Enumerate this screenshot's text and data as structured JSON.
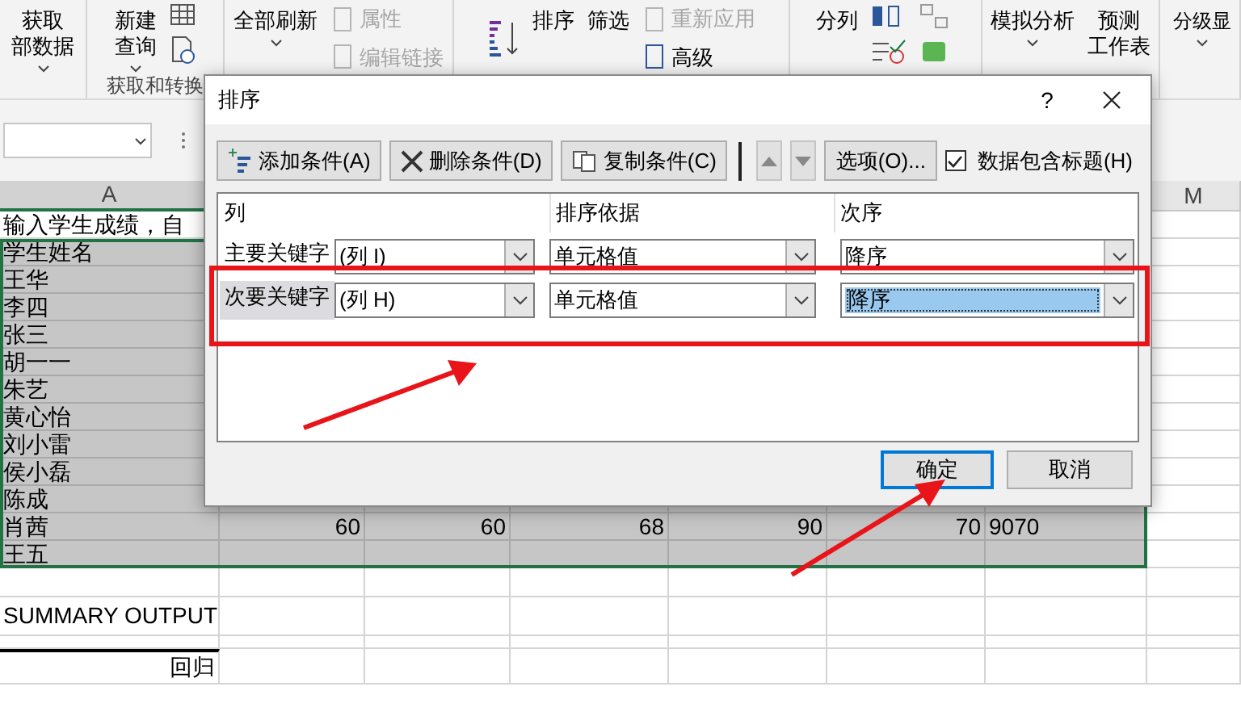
{
  "ribbon": {
    "groups": [
      {
        "items": [
          {
            "kind": "large",
            "lines": [
              "获取",
              "部数据"
            ],
            "caret": true
          }
        ]
      },
      {
        "label": "获取和转换",
        "items": [
          {
            "kind": "large",
            "lines": [
              "新建",
              "查询"
            ],
            "caret": true
          },
          {
            "kind": "icon_column"
          }
        ]
      },
      {
        "items": [
          {
            "kind": "large",
            "lines": [
              "全部刷新"
            ],
            "caret": true
          },
          {
            "kind": "stack",
            "items": [
              {
                "text": "属性",
                "disabled": true
              },
              {
                "text": "编辑链接",
                "disabled": true
              }
            ]
          }
        ]
      },
      {
        "items": [
          {
            "kind": "sort_icon"
          },
          {
            "kind": "large",
            "lines": [
              "排序"
            ],
            "caret": false
          },
          {
            "kind": "large",
            "lines": [
              "筛选"
            ],
            "caret": false
          },
          {
            "kind": "stack",
            "items": [
              {
                "text": "重新应用",
                "disabled": true
              },
              {
                "text": "高级",
                "disabled": false
              }
            ]
          }
        ]
      },
      {
        "items": [
          {
            "kind": "large",
            "lines": [
              "分列"
            ],
            "caret": false
          },
          {
            "kind": "icon_grid"
          }
        ]
      },
      {
        "items": [
          {
            "kind": "large",
            "lines": [
              "模拟分析"
            ],
            "caret": true
          },
          {
            "kind": "large",
            "lines": [
              "预测",
              "工作表"
            ],
            "caret": false
          }
        ]
      },
      {
        "items": [
          {
            "kind": "large",
            "lines": [
              "分级显"
            ],
            "caret": true
          }
        ]
      }
    ]
  },
  "sheet": {
    "column_headers": [
      "A",
      "M"
    ],
    "rows": [
      {
        "cells": [
          "输入学生成绩，自"
        ],
        "selected": false
      },
      {
        "cells": [
          "学生姓名"
        ],
        "selected": true
      },
      {
        "cells": [
          "王华"
        ],
        "selected": true
      },
      {
        "cells": [
          "李四"
        ],
        "selected": true
      },
      {
        "cells": [
          "张三"
        ],
        "selected": true
      },
      {
        "cells": [
          "胡一一"
        ],
        "selected": true
      },
      {
        "cells": [
          "朱艺"
        ],
        "selected": true
      },
      {
        "cells": [
          "黄心怡"
        ],
        "selected": true
      },
      {
        "cells": [
          "刘小雷"
        ],
        "selected": true
      },
      {
        "cells": [
          "侯小磊"
        ],
        "selected": true
      },
      {
        "cells": [
          "陈成"
        ],
        "selected": true
      },
      {
        "cells": [
          "肖茜",
          "60",
          "60",
          "68",
          "90",
          "70",
          "9070"
        ],
        "selected": true
      },
      {
        "cells": [
          "王五"
        ],
        "selected": true
      }
    ],
    "summary": {
      "title": "SUMMARY OUTPUT",
      "table_heading": "回归"
    }
  },
  "dialog": {
    "title": "排序",
    "help": "?",
    "toolbar": [
      {
        "kind": "add",
        "label": "添加条件(A)"
      },
      {
        "kind": "delete",
        "label": "删除条件(D)"
      },
      {
        "kind": "copy",
        "label": "复制条件(C)"
      },
      {
        "kind": "up"
      },
      {
        "kind": "down"
      },
      {
        "kind": "text",
        "label": "选项(O)..."
      }
    ],
    "has_headers": {
      "label": "数据包含标题(H)",
      "checked": true
    },
    "columns": [
      "列",
      "排序依据",
      "次序"
    ],
    "levels": [
      {
        "label": "主要关键字",
        "column": "(列 I)",
        "sort_on": "单元格值",
        "order": "降序",
        "selected": false
      },
      {
        "label": "次要关键字",
        "column": "(列 H)",
        "sort_on": "单元格值",
        "order": "降序",
        "selected": true
      }
    ],
    "buttons": [
      {
        "label": "确定",
        "default": true
      },
      {
        "label": "取消",
        "default": false
      }
    ]
  }
}
